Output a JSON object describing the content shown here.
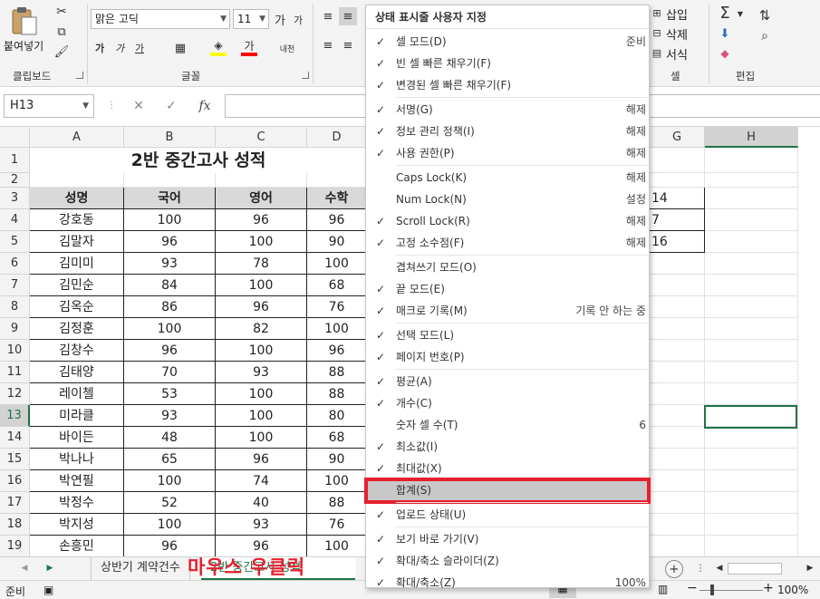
{
  "ribbon": {
    "paste_label": "붙여넣기",
    "clipboard_label": "클립보드",
    "font_name": "맑은 고딕",
    "font_size": "11",
    "grow_font": "가",
    "shrink_font": "가",
    "bold": "가",
    "italic": "가",
    "underline": "가",
    "font_color_glyph": "가",
    "phonetic": "내천",
    "font_group_label": "글꼴",
    "insert_label": "삽입",
    "delete_label": "삭제",
    "format_label": "서식",
    "cells_group_label": "셀",
    "edit_group_label": "편집"
  },
  "formula_bar": {
    "name_box": "H13",
    "fx": "fx"
  },
  "grid": {
    "columns": [
      "A",
      "B",
      "C",
      "D",
      "G",
      "H"
    ],
    "rows": [
      "1",
      "2",
      "3",
      "4",
      "5",
      "6",
      "7",
      "8",
      "9",
      "10",
      "11",
      "12",
      "13",
      "14",
      "15",
      "16",
      "17",
      "18",
      "19"
    ],
    "title": "2반 중간고사 성적",
    "headers": [
      "성명",
      "국어",
      "영어",
      "수학"
    ],
    "data": [
      [
        "강호동",
        "100",
        "96",
        "96"
      ],
      [
        "김말자",
        "96",
        "100",
        "90"
      ],
      [
        "김미미",
        "93",
        "78",
        "100"
      ],
      [
        "김민순",
        "84",
        "100",
        "68"
      ],
      [
        "김옥순",
        "86",
        "96",
        "76"
      ],
      [
        "김정훈",
        "100",
        "82",
        "100"
      ],
      [
        "김창수",
        "96",
        "100",
        "96"
      ],
      [
        "김태양",
        "70",
        "93",
        "88"
      ],
      [
        "레이첼",
        "53",
        "100",
        "88"
      ],
      [
        "미라클",
        "93",
        "100",
        "80"
      ],
      [
        "바이든",
        "48",
        "100",
        "68"
      ],
      [
        "박나나",
        "65",
        "96",
        "90"
      ],
      [
        "박연필",
        "100",
        "74",
        "100"
      ],
      [
        "박정수",
        "52",
        "40",
        "88"
      ],
      [
        "박지성",
        "100",
        "93",
        "76"
      ],
      [
        "손흥민",
        "96",
        "96",
        "100"
      ]
    ],
    "g_values": [
      "14",
      "7",
      "16"
    ]
  },
  "tabs": {
    "sheet1": "상반기 계약건수",
    "sheet2": "2반 중간고사 성적",
    "callout": "마우스 우클릭"
  },
  "status": {
    "mode": "준비",
    "zoom": "100%"
  },
  "menu": {
    "title": "상태 표시줄 사용자 지정",
    "items": [
      {
        "check": "✓",
        "label": "셀 모드(D)",
        "value": "준비"
      },
      {
        "check": "✓",
        "label": "빈 셀 빠른 채우기(F)",
        "value": ""
      },
      {
        "check": "✓",
        "label": "변경된 셀 빠른 채우기(F)",
        "value": ""
      },
      {
        "check": "✓",
        "label": "서명(G)",
        "value": "해제"
      },
      {
        "check": "✓",
        "label": "정보 관리 정책(I)",
        "value": "해제"
      },
      {
        "check": "✓",
        "label": "사용 권한(P)",
        "value": "해제"
      },
      {
        "check": "",
        "label": "Caps Lock(K)",
        "value": "해제"
      },
      {
        "check": "",
        "label": "Num Lock(N)",
        "value": "설정"
      },
      {
        "check": "✓",
        "label": "Scroll Lock(R)",
        "value": "해제"
      },
      {
        "check": "✓",
        "label": "고정 소수점(F)",
        "value": "해제"
      },
      {
        "check": "",
        "label": "겹쳐쓰기 모드(O)",
        "value": ""
      },
      {
        "check": "✓",
        "label": "끝 모드(E)",
        "value": ""
      },
      {
        "check": "✓",
        "label": "매크로 기록(M)",
        "value": "기록 안 하는 중"
      },
      {
        "check": "✓",
        "label": "선택 모드(L)",
        "value": ""
      },
      {
        "check": "✓",
        "label": "페이지 번호(P)",
        "value": ""
      },
      {
        "check": "✓",
        "label": "평균(A)",
        "value": ""
      },
      {
        "check": "✓",
        "label": "개수(C)",
        "value": ""
      },
      {
        "check": "",
        "label": "숫자 셀 수(T)",
        "value": "6"
      },
      {
        "check": "✓",
        "label": "최소값(I)",
        "value": ""
      },
      {
        "check": "✓",
        "label": "최대값(X)",
        "value": ""
      },
      {
        "check": "",
        "label": "합계(S)",
        "value": ""
      },
      {
        "check": "✓",
        "label": "업로드 상태(U)",
        "value": ""
      },
      {
        "check": "✓",
        "label": "보기 바로 가기(V)",
        "value": ""
      },
      {
        "check": "✓",
        "label": "확대/축소 슬라이더(Z)",
        "value": ""
      },
      {
        "check": "✓",
        "label": "확대/축소(Z)",
        "value": "100%"
      }
    ]
  },
  "colors": {
    "excel_green": "#217346",
    "highlight_red": "#e5202e"
  }
}
